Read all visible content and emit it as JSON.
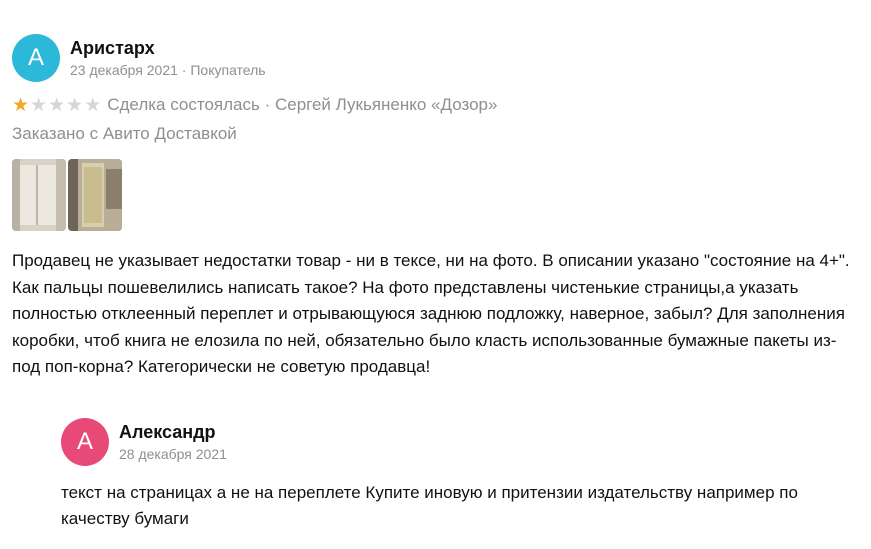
{
  "review": {
    "author": {
      "initial": "А",
      "name": "Аристарх",
      "avatar_color": "#2bb8d9"
    },
    "date": "23 декабря 2021",
    "separator": " · ",
    "role": "Покупатель",
    "rating": {
      "value": 1,
      "max": 5,
      "filled_color": "#f5a623",
      "empty_color": "#d6d6d6"
    },
    "deal_status": "Сделка состоялась · Сергей Лукьяненко «Дозор»",
    "delivery": "Заказано с Авито Доставкой",
    "photos": [
      {
        "icon": "book-photo-1"
      },
      {
        "icon": "book-photo-2"
      }
    ],
    "text": "Продавец не указывает недостатки товар - ни в тексе, ни на фото. В описании указано \"состояние на 4+\". Как пальцы пошевелились написать такое? На фото представлены чистенькие страницы,а указать полностью отклеенный переплет и отрывающуюся заднюю подложку, наверное, забыл? Для заполнения коробки, чтоб книга не елозила по ней, обязательно было класть использованные бумажные пакеты из-под поп-корна? Категорически не советую продавца!"
  },
  "reply": {
    "author": {
      "initial": "А",
      "name": "Александр",
      "avatar_color": "#e84a78"
    },
    "date": "28 декабря 2021",
    "text": "текст на страницах а не на переплете Купите иновую и притензии издательству например по качеству бумаги"
  }
}
